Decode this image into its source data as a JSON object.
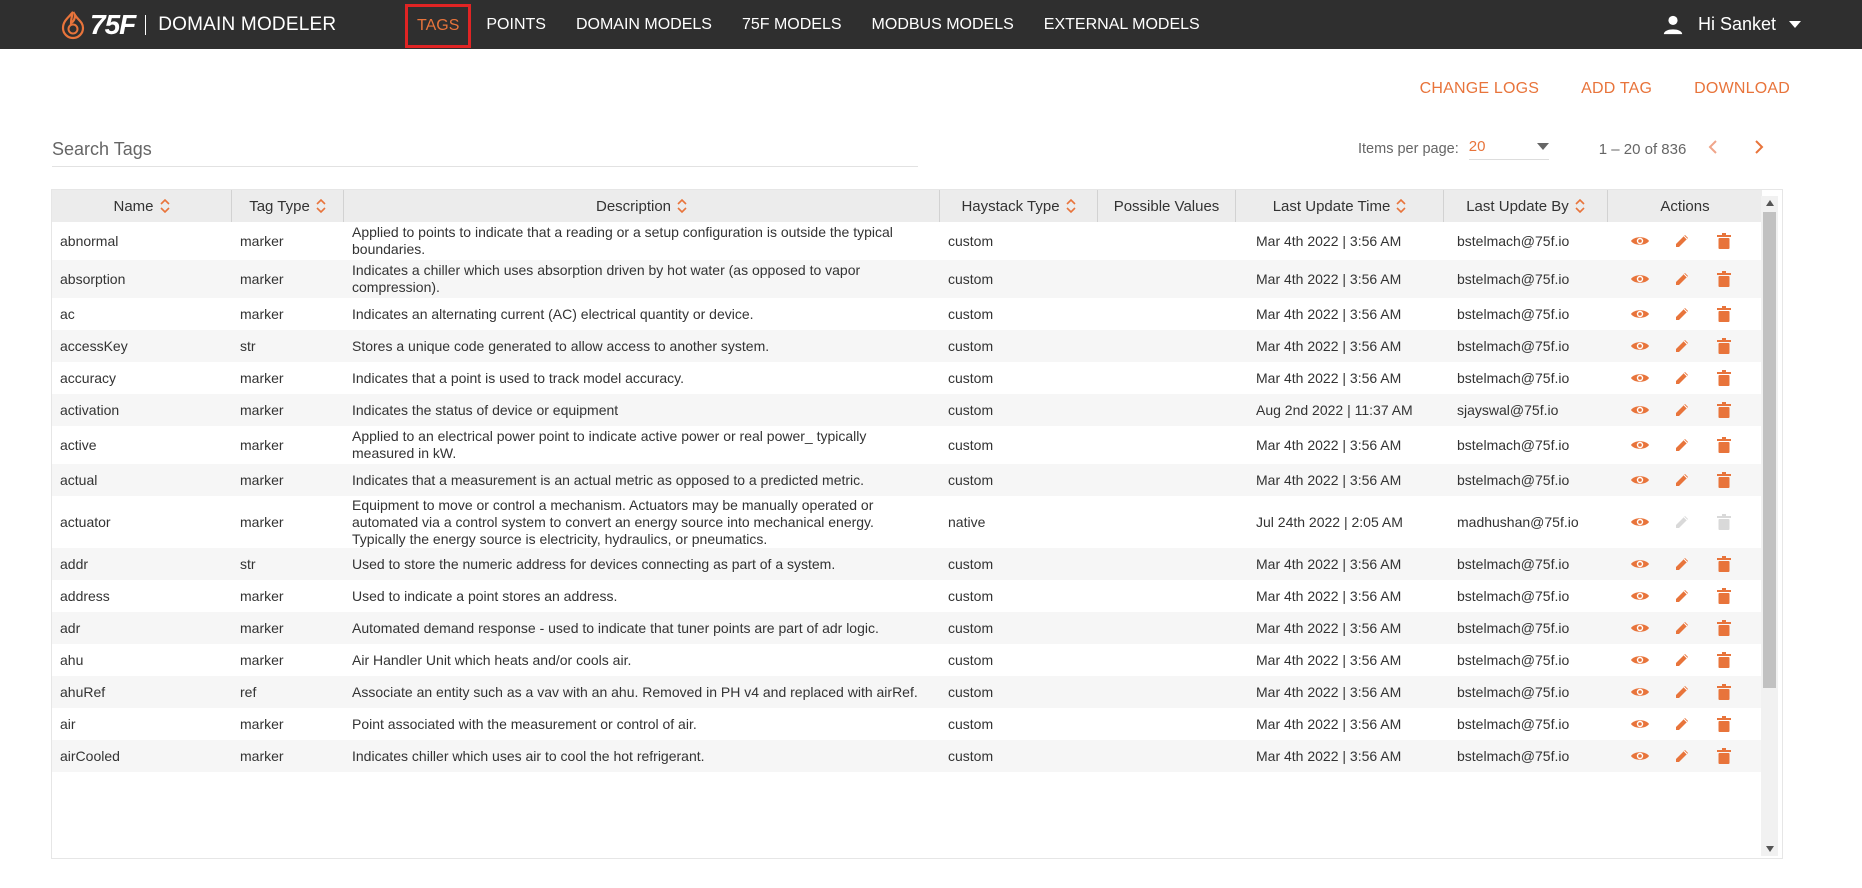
{
  "brand": {
    "logo_text": "75F",
    "app_name": "DOMAIN MODELER"
  },
  "nav": [
    {
      "label": "TAGS",
      "active": true
    },
    {
      "label": "POINTS"
    },
    {
      "label": "DOMAIN MODELS"
    },
    {
      "label": "75F MODELS"
    },
    {
      "label": "MODBUS MODELS"
    },
    {
      "label": "EXTERNAL MODELS"
    }
  ],
  "user": {
    "greeting": "Hi Sanket"
  },
  "actions": {
    "change_logs": "CHANGE LOGS",
    "add_tag": "ADD TAG",
    "download": "DOWNLOAD"
  },
  "search": {
    "placeholder": "Search Tags",
    "value": ""
  },
  "paging": {
    "items_per_page_label": "Items per page:",
    "items_per_page": "20",
    "range": "1 – 20 of 836"
  },
  "colors": {
    "accent": "#e8743b",
    "topbar": "#2f2f2f",
    "active_outline": "#e02424"
  },
  "table": {
    "columns": [
      "Name",
      "Tag Type",
      "Description",
      "Haystack Type",
      "Possible Values",
      "Last Update Time",
      "Last Update By",
      "Actions"
    ],
    "rows": [
      {
        "name": "abnormal",
        "type": "marker",
        "description": "Applied to points to indicate that a reading or a setup configuration is outside the typical boundaries.",
        "haystack": "custom",
        "possible": "",
        "time": "Mar 4th 2022 | 3:56 AM",
        "by": "bstelmach@75f.io",
        "editable": true
      },
      {
        "name": "absorption",
        "type": "marker",
        "description": "Indicates a chiller which uses absorption driven by hot water (as opposed to vapor compression).",
        "haystack": "custom",
        "possible": "",
        "time": "Mar 4th 2022 | 3:56 AM",
        "by": "bstelmach@75f.io",
        "editable": true
      },
      {
        "name": "ac",
        "type": "marker",
        "description": "Indicates an alternating current (AC) electrical quantity or device.",
        "haystack": "custom",
        "possible": "",
        "time": "Mar 4th 2022 | 3:56 AM",
        "by": "bstelmach@75f.io",
        "editable": true
      },
      {
        "name": "accessKey",
        "type": "str",
        "description": "Stores a unique code generated to allow access to another system.",
        "haystack": "custom",
        "possible": "",
        "time": "Mar 4th 2022 | 3:56 AM",
        "by": "bstelmach@75f.io",
        "editable": true
      },
      {
        "name": "accuracy",
        "type": "marker",
        "description": "Indicates that a point is used to track model accuracy.",
        "haystack": "custom",
        "possible": "",
        "time": "Mar 4th 2022 | 3:56 AM",
        "by": "bstelmach@75f.io",
        "editable": true
      },
      {
        "name": "activation",
        "type": "marker",
        "description": "Indicates the status of device or equipment",
        "haystack": "custom",
        "possible": "",
        "time": "Aug 2nd 2022 | 11:37 AM",
        "by": "sjayswal@75f.io",
        "editable": true
      },
      {
        "name": "active",
        "type": "marker",
        "description": "Applied to an electrical power point to indicate active power or real power_ typically measured in kW.",
        "haystack": "custom",
        "possible": "",
        "time": "Mar 4th 2022 | 3:56 AM",
        "by": "bstelmach@75f.io",
        "editable": true
      },
      {
        "name": "actual",
        "type": "marker",
        "description": "Indicates that a measurement is an actual metric as opposed to a predicted metric.",
        "haystack": "custom",
        "possible": "",
        "time": "Mar 4th 2022 | 3:56 AM",
        "by": "bstelmach@75f.io",
        "editable": true
      },
      {
        "name": "actuator",
        "type": "marker",
        "description": "Equipment to move or control a mechanism. Actuators may be manually operated or automated via a control system to convert an energy source into mechanical energy. Typically the energy source is electricity, hydraulics, or pneumatics.",
        "haystack": "native",
        "possible": "",
        "time": "Jul 24th 2022 | 2:05 AM",
        "by": "madhushan@75f.io",
        "editable": false
      },
      {
        "name": "addr",
        "type": "str",
        "description": "Used to store the numeric address for devices connecting as part of a system.",
        "haystack": "custom",
        "possible": "",
        "time": "Mar 4th 2022 | 3:56 AM",
        "by": "bstelmach@75f.io",
        "editable": true
      },
      {
        "name": "address",
        "type": "marker",
        "description": "Used to indicate a point stores an address.",
        "haystack": "custom",
        "possible": "",
        "time": "Mar 4th 2022 | 3:56 AM",
        "by": "bstelmach@75f.io",
        "editable": true
      },
      {
        "name": "adr",
        "type": "marker",
        "description": "Automated demand response - used to indicate that tuner points are part of adr logic.",
        "haystack": "custom",
        "possible": "",
        "time": "Mar 4th 2022 | 3:56 AM",
        "by": "bstelmach@75f.io",
        "editable": true
      },
      {
        "name": "ahu",
        "type": "marker",
        "description": "Air Handler Unit which heats and/or cools air.",
        "haystack": "custom",
        "possible": "",
        "time": "Mar 4th 2022 | 3:56 AM",
        "by": "bstelmach@75f.io",
        "editable": true
      },
      {
        "name": "ahuRef",
        "type": "ref",
        "description": "Associate an entity such as a vav with an ahu. Removed in PH v4 and replaced with airRef.",
        "haystack": "custom",
        "possible": "",
        "time": "Mar 4th 2022 | 3:56 AM",
        "by": "bstelmach@75f.io",
        "editable": true
      },
      {
        "name": "air",
        "type": "marker",
        "description": "Point associated with the measurement or control of air.",
        "haystack": "custom",
        "possible": "",
        "time": "Mar 4th 2022 | 3:56 AM",
        "by": "bstelmach@75f.io",
        "editable": true
      },
      {
        "name": "airCooled",
        "type": "marker",
        "description": "Indicates chiller which uses air to cool the hot refrigerant.",
        "haystack": "custom",
        "possible": "",
        "time": "Mar 4th 2022 | 3:56 AM",
        "by": "bstelmach@75f.io",
        "editable": true
      }
    ]
  }
}
